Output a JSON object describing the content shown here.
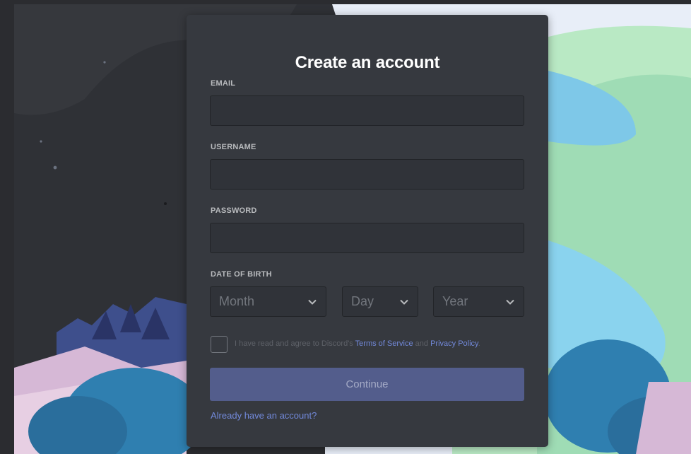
{
  "form": {
    "title": "Create an account",
    "email": {
      "label": "EMAIL",
      "value": ""
    },
    "username": {
      "label": "USERNAME",
      "value": ""
    },
    "password": {
      "label": "PASSWORD",
      "value": ""
    },
    "date_of_birth": {
      "label": "DATE OF BIRTH",
      "month_placeholder": "Month",
      "day_placeholder": "Day",
      "year_placeholder": "Year"
    },
    "agreement": {
      "prefix": "I have read and agree to Discord's",
      "terms_link": "Terms of Service",
      "conjunction": "and",
      "privacy_link": "Privacy Policy",
      "suffix": ".",
      "checked": false
    },
    "continue_label": "Continue",
    "login_link": "Already have an account?"
  },
  "colors": {
    "card_bg": "#36393f",
    "input_bg": "#303339",
    "button_bg": "#535d8c",
    "link": "#7289da",
    "label": "#b9bbbe"
  }
}
